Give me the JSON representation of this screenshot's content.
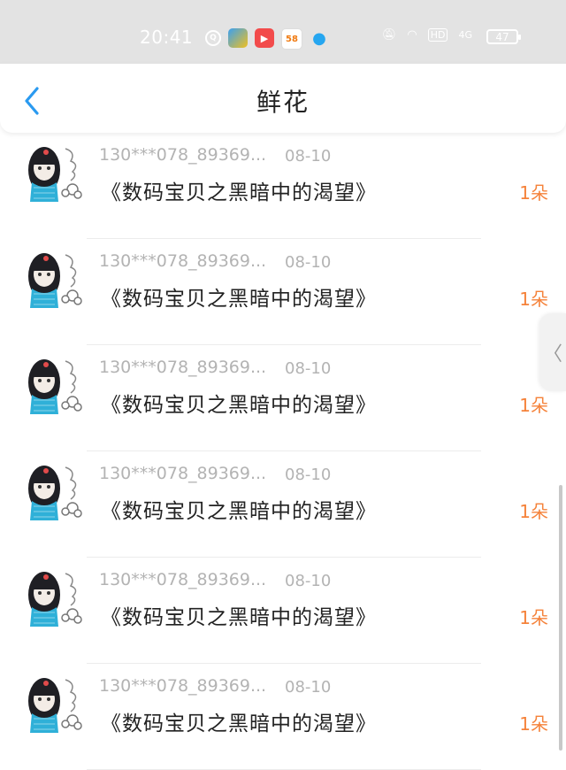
{
  "status_bar": {
    "time": "20:41",
    "network": "4G",
    "hd": "HD",
    "battery": "47"
  },
  "header": {
    "title": "鲜花"
  },
  "side_handle": {
    "glyph": "〈"
  },
  "items": [
    {
      "user": "130***078_89369...",
      "date": "08-10",
      "title": "《数码宝贝之黑暗中的渴望》",
      "count": "1朵"
    },
    {
      "user": "130***078_89369...",
      "date": "08-10",
      "title": "《数码宝贝之黑暗中的渴望》",
      "count": "1朵"
    },
    {
      "user": "130***078_89369...",
      "date": "08-10",
      "title": "《数码宝贝之黑暗中的渴望》",
      "count": "1朵"
    },
    {
      "user": "130***078_89369...",
      "date": "08-10",
      "title": "《数码宝贝之黑暗中的渴望》",
      "count": "1朵"
    },
    {
      "user": "130***078_89369...",
      "date": "08-10",
      "title": "《数码宝贝之黑暗中的渴望》",
      "count": "1朵"
    },
    {
      "user": "130***078_89369...",
      "date": "08-10",
      "title": "《数码宝贝之黑暗中的渴望》",
      "count": "1朵"
    }
  ],
  "colors": {
    "accent": "#2a9af0",
    "count": "#f5823a",
    "muted": "#b3b3b3"
  }
}
